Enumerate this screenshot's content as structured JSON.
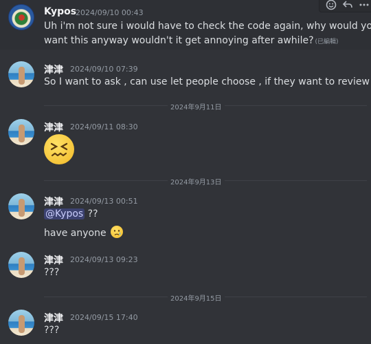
{
  "toolbar": {
    "icons": [
      "add-reaction-icon",
      "reply-icon",
      "more-options-icon"
    ]
  },
  "messages": [
    {
      "author": "Kypos",
      "timestamp": "2024/09/10 00:43",
      "lines": [
        "Uh i'm not sure i would have to check the code again, why would you",
        "want this anyway wouldn't it get annoying after awhile?"
      ],
      "edited": "(已編輯)"
    },
    {
      "author": "津津",
      "timestamp": "2024/09/10 07:39",
      "lines": [
        "So I want to ask , can use let people choose , if they want to review ."
      ]
    },
    {
      "author": "津津",
      "timestamp": "2024/09/11 08:30",
      "emoji": "confounded-face-emoji"
    },
    {
      "author": "津津",
      "timestamp": "2024/09/13 00:51",
      "mention": "@Kypos",
      "mention_after": " ??",
      "line2": "have anyone",
      "emoji": "crying-face-emoji"
    },
    {
      "author": "津津",
      "timestamp": "2024/09/13 09:23",
      "lines": [
        "???"
      ]
    },
    {
      "author": "津津",
      "timestamp": "2024/09/15 17:40",
      "lines": [
        "???"
      ]
    }
  ],
  "dividers": [
    "2024年9月11日",
    "2024年9月13日",
    "2024年9月15日"
  ]
}
